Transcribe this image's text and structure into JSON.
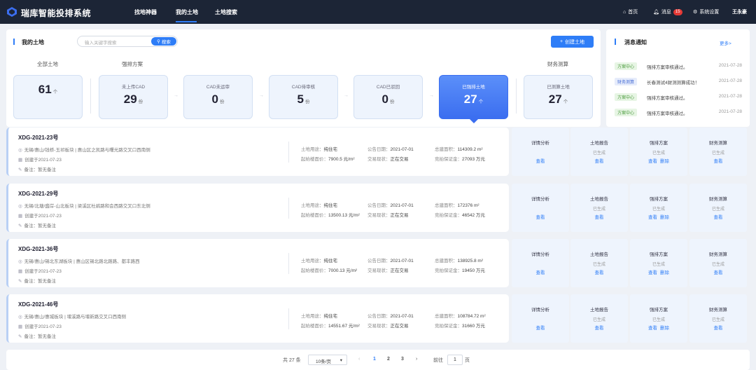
{
  "app": {
    "title": "瑞库智能投排系统",
    "user": "王永豪"
  },
  "nav": [
    "找地神器",
    "我的土地",
    "土地搜索"
  ],
  "topright": {
    "home": "首页",
    "msg": "消息",
    "msg_count": "15",
    "settings": "系统设置"
  },
  "myland": {
    "title": "我的土地",
    "search_placeholder": "输入关键字搜索",
    "search_btn": "搜索",
    "create_btn": "创建土地",
    "groups": {
      "all": "全部土地",
      "plan": "强排方案",
      "fin": "财务测算"
    },
    "cards": [
      {
        "label": "",
        "value": "61",
        "unit": "个"
      },
      {
        "label": "未上传CAD",
        "value": "29",
        "unit": "份"
      },
      {
        "label": "CAD未运审",
        "value": "0",
        "unit": "份"
      },
      {
        "label": "CAD待审核",
        "value": "5",
        "unit": "份"
      },
      {
        "label": "CAD已驳回",
        "value": "0",
        "unit": "份"
      },
      {
        "label": "已强排土地",
        "value": "27",
        "unit": "个"
      },
      {
        "label": "已测算土地",
        "value": "27",
        "unit": "个"
      }
    ]
  },
  "notice": {
    "title": "消息通知",
    "more": "更多>",
    "items": [
      {
        "tag": "方案中心",
        "text": "强排方案审核通过。",
        "date": "2021-07-28"
      },
      {
        "tag": "财务测算",
        "text": "长春测试4财测测算成功！",
        "date": "2021-07-28"
      },
      {
        "tag": "方案中心",
        "text": "强排方案审核通过。",
        "date": "2021-07-28"
      },
      {
        "tag": "方案中心",
        "text": "强排方案审核通过。",
        "date": "2021-07-28"
      }
    ]
  },
  "labels": {
    "use": "土地用途：",
    "price": "起始楼面价：",
    "pub": "公告日期：",
    "status": "交易现状：",
    "area": "总建面积：",
    "deposit": "竞拍保证金：",
    "remark_prefix": "备注：",
    "view": "查看",
    "del": "删除",
    "generated": "已生成"
  },
  "actions": [
    "详情分析",
    "土地报告",
    "强排方案",
    "财务测算"
  ],
  "lands": [
    {
      "name": "XDG-2021-23号",
      "loc": "无锡/惠山/钱桥-玉祁板块 | 惠山区之凯路与曙光路交叉口西南侧",
      "created": "创建于2021-07-23",
      "remark": "暂无备注",
      "use": "纯住宅",
      "price": "7900.5 元/m²",
      "pub": "2021-07-01",
      "status": "正在交易",
      "area": "114309.2 m²",
      "deposit": "27093 万元"
    },
    {
      "name": "XDG-2021-29号",
      "loc": "无锡/北塘/盛岸-山北板块 | 梁溪区杜鹃路和会西路交叉口东北侧",
      "created": "创建于2021-07-23",
      "remark": "暂无备注",
      "use": "纯住宅",
      "price": "13500.13 元/m²",
      "pub": "2021-07-01",
      "status": "正在交易",
      "area": "172376 m²",
      "deposit": "46542 万元"
    },
    {
      "name": "XDG-2021-36号",
      "loc": "无锡/惠山/锡北东湖板块 | 惠山区锡北路北路路、都丰路西",
      "created": "创建于2021-07-23",
      "remark": "暂无备注",
      "use": "纯住宅",
      "price": "7000.13 元/m²",
      "pub": "2021-07-01",
      "status": "正在交易",
      "area": "138925.8 m²",
      "deposit": "19450 万元"
    },
    {
      "name": "XDG-2021-46号",
      "loc": "无锡/惠山/惠城板块 | 堰溪路与堰新路交叉口西南侧",
      "created": "创建于2021-07-23",
      "remark": "暂无备注",
      "use": "纯住宅",
      "price": "14551.67 元/m²",
      "pub": "2021-07-01",
      "status": "正在交易",
      "area": "108784.72 m²",
      "deposit": "31660 万元"
    }
  ],
  "pagination": {
    "total": "共 27 条",
    "size": "10条/页",
    "pages": [
      "1",
      "2",
      "3"
    ],
    "goto": "前往",
    "page_input": "1",
    "page_suffix": "页"
  }
}
